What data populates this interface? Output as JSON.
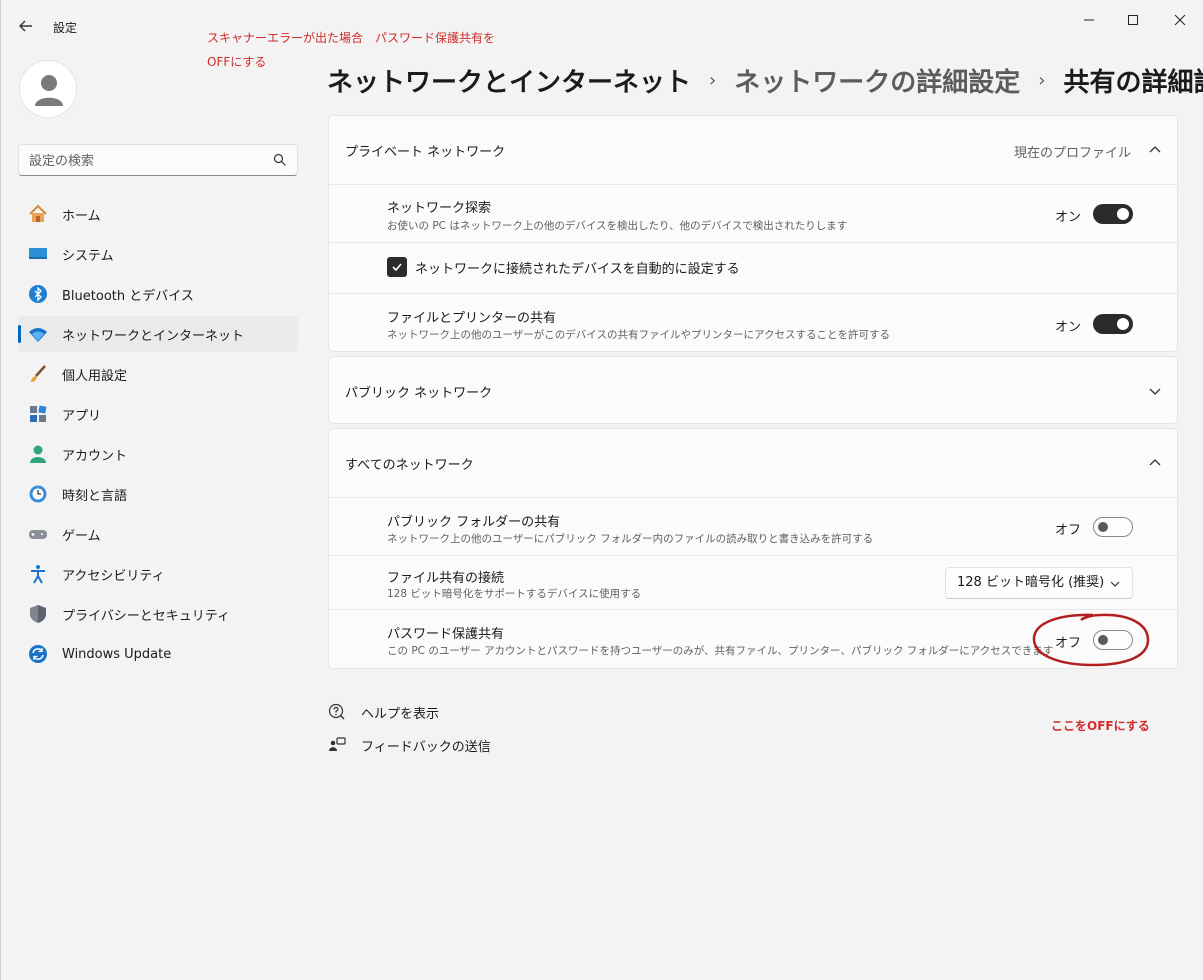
{
  "window": {
    "app_title": "設定",
    "controls": {
      "minimize": "minimize-icon",
      "maximize": "maximize-icon",
      "close": "close-icon"
    }
  },
  "annotations": {
    "top_line1": "スキャナーエラーが出た場合　パスワード保護共有を",
    "top_line2": "OFFにする",
    "side_note": "ここをOFFにする",
    "color": "#d12b2b"
  },
  "sidebar": {
    "search": {
      "placeholder": "設定の検索"
    },
    "items": [
      {
        "label": "ホーム",
        "icon": "home-icon"
      },
      {
        "label": "システム",
        "icon": "system-icon"
      },
      {
        "label": "Bluetooth とデバイス",
        "icon": "bluetooth-icon"
      },
      {
        "label": "ネットワークとインターネット",
        "icon": "wifi-icon",
        "active": true
      },
      {
        "label": "個人用設定",
        "icon": "brush-icon"
      },
      {
        "label": "アプリ",
        "icon": "apps-icon"
      },
      {
        "label": "アカウント",
        "icon": "account-icon"
      },
      {
        "label": "時刻と言語",
        "icon": "clock-globe-icon"
      },
      {
        "label": "ゲーム",
        "icon": "gamepad-icon"
      },
      {
        "label": "アクセシビリティ",
        "icon": "accessibility-icon"
      },
      {
        "label": "プライバシーとセキュリティ",
        "icon": "shield-icon"
      },
      {
        "label": "Windows Update",
        "icon": "update-icon"
      }
    ]
  },
  "breadcrumb": {
    "level1": "ネットワークとインターネット",
    "level2": "ネットワークの詳細設定",
    "current": "共有の詳細設定",
    "separator": "›"
  },
  "private_network": {
    "header": "プライベート ネットワーク",
    "current_profile": "現在のプロファイル",
    "discovery": {
      "title": "ネットワーク探索",
      "desc": "お使いの PC はネットワーク上の他のデバイスを検出したり、他のデバイスで検出されたりします",
      "state": "オン"
    },
    "auto_setup": {
      "label": "ネットワークに接続されたデバイスを自動的に設定する",
      "checked": true
    },
    "file_printer": {
      "title": "ファイルとプリンターの共有",
      "desc": "ネットワーク上の他のユーザーがこのデバイスの共有ファイルやプリンターにアクセスすることを許可する",
      "state": "オン"
    }
  },
  "public_network": {
    "header": "パブリック ネットワーク"
  },
  "all_networks": {
    "header": "すべてのネットワーク",
    "public_folder": {
      "title": "パブリック フォルダーの共有",
      "desc": "ネットワーク上の他のユーザーにパブリック フォルダー内のファイルの読み取りと書き込みを許可する",
      "state": "オフ"
    },
    "file_sharing": {
      "title": "ファイル共有の接続",
      "desc": "128 ビット暗号化をサポートするデバイスに使用する",
      "selected": "128 ビット暗号化 (推奨)"
    },
    "password_sharing": {
      "title": "パスワード保護共有",
      "desc": "この PC のユーザー アカウントとパスワードを持つユーザーのみが、共有ファイル、プリンター、パブリック フォルダーにアクセスできます",
      "state": "オフ"
    }
  },
  "footer": {
    "help": "ヘルプを表示",
    "feedback": "フィードバックの送信"
  }
}
